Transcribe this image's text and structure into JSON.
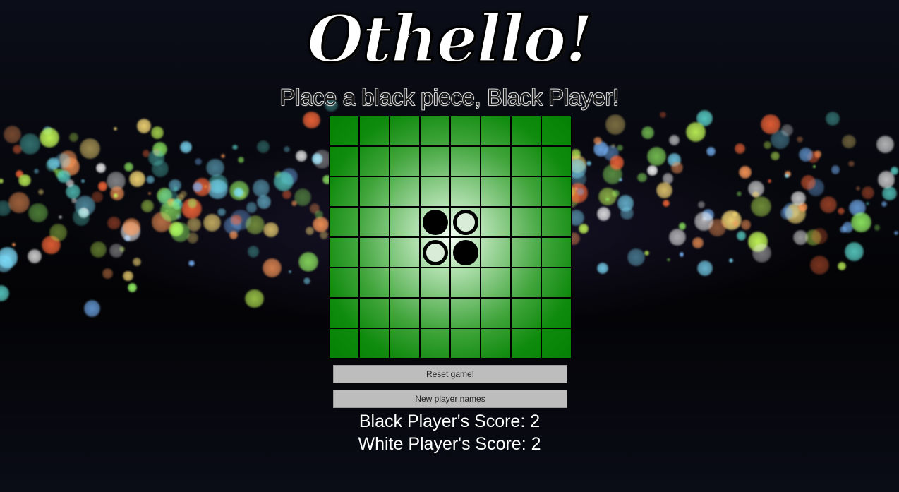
{
  "header": {
    "title": "Othello!",
    "turn_message": "Place a black piece, Black Player!"
  },
  "board": {
    "size": 8,
    "pieces": [
      {
        "row": 3,
        "col": 3,
        "color": "black"
      },
      {
        "row": 3,
        "col": 4,
        "color": "white"
      },
      {
        "row": 4,
        "col": 3,
        "color": "white"
      },
      {
        "row": 4,
        "col": 4,
        "color": "black"
      }
    ]
  },
  "controls": {
    "reset_label": "Reset game!",
    "new_names_label": "New player names"
  },
  "scores": {
    "black_label": "Black Player's Score: ",
    "black_value": "2",
    "white_label": "White Player's Score: ",
    "white_value": "2"
  },
  "colors": {
    "board_green": "#048004",
    "button_gray": "#bdbdbd"
  }
}
